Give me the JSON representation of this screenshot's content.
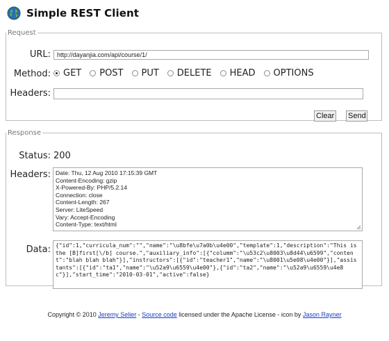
{
  "app": {
    "title": "Simple REST Client"
  },
  "request": {
    "legend": "Request",
    "url_label": "URL:",
    "url_value": "http://dayanjia.com/api/course/1/",
    "method_label": "Method:",
    "methods": [
      "GET",
      "POST",
      "PUT",
      "DELETE",
      "HEAD",
      "OPTIONS"
    ],
    "selected_method": "GET",
    "headers_label": "Headers:",
    "headers_value": "",
    "clear_label": "Clear",
    "send_label": "Send"
  },
  "response": {
    "legend": "Response",
    "status_label": "Status:",
    "status_value": "200",
    "headers_label": "Headers:",
    "headers_lines": [
      "Date: Thu, 12 Aug 2010 17:15:39 GMT",
      "Content-Encoding: gzip",
      "X-Powered-By: PHP/5.2.14",
      "Connection: close",
      "Content-Length: 267",
      "Server: LiteSpeed",
      "Vary: Accept-Encoding",
      "Content-Type: text/html"
    ],
    "data_label": "Data:",
    "data_value": "{\"id\":1,\"curricula_num\":\"\",\"name\":\"\\u8bfe\\u7a0b\\u4e00\",\"template\":1,\"description\":\"This is the [B]first[\\/b] course.\",\"auxiliary_info\":[{\"columm\":\"\\u53c2\\u8003\\u8d44\\u6599\",\"content\":\"blah blah blah\"}],\"instructors\":[{\"id\":\"teacher1\",\"name\":\"\\u8001\\u5e08\\u4e00\"}],\"assistants\":[{\"id\":\"ta1\",\"name\":\"\\u52a9\\u6559\\u4e00\"},{\"id\":\"ta2\",\"name\":\"\\u52a9\\u6559\\u4e8c\"}],\"start_time\":\"2010-03-01\",\"active\":false}"
  },
  "footer": {
    "prefix": "Copyright © 2010 ",
    "author_link": "Jeremy Selier",
    "sep1": " - ",
    "source_link": "Source code",
    "middle": " licensed under the Apache License - icon by ",
    "icon_author_link": "Jason Rayner"
  },
  "colors": {
    "link": "#1a3bbf",
    "border": "#a9a9a9",
    "legend": "#777777"
  },
  "icons": {
    "logo": "globe-icon",
    "resize": "resize-grip-icon"
  }
}
